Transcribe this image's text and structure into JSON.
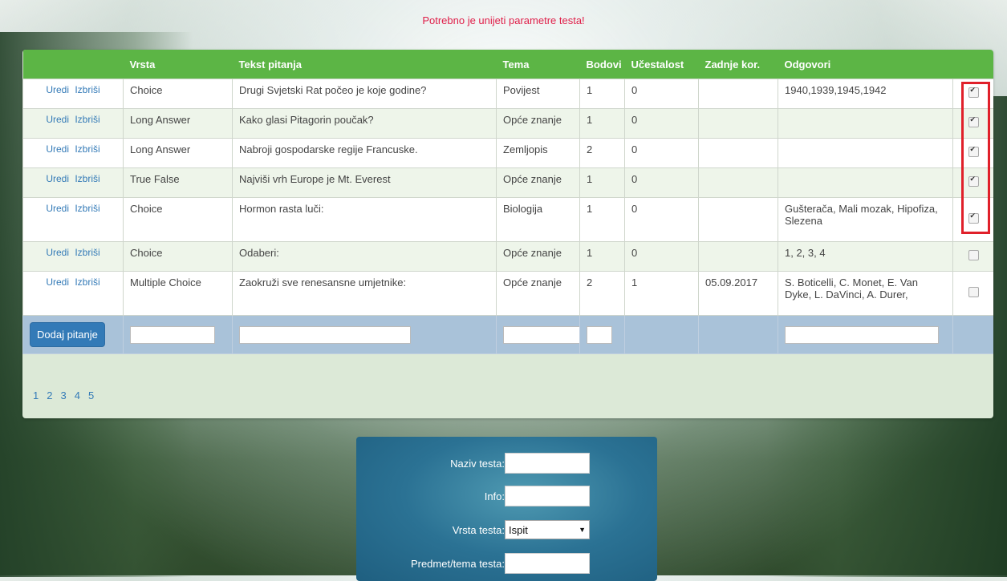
{
  "alert": "Potrebno je unijeti parametre testa!",
  "table": {
    "headers": [
      "",
      "Vrsta",
      "Tekst pitanja",
      "Tema",
      "Bodovi",
      "Učestalost",
      "Zadnje kor.",
      "Odgovori",
      ""
    ],
    "edit_label": "Uredi",
    "delete_label": "Izbriši",
    "rows": [
      {
        "vrsta": "Choice",
        "tekst": "Drugi Svjetski Rat počeo je koje godine?",
        "tema": "Povijest",
        "bodovi": "1",
        "ucestalost": "0",
        "zadnje": "",
        "odgovori": "1940,1939,1945,1942",
        "checked": true
      },
      {
        "vrsta": "Long Answer",
        "tekst": "Kako glasi Pitagorin poučak?",
        "tema": "Opće znanje",
        "bodovi": "1",
        "ucestalost": "0",
        "zadnje": "",
        "odgovori": "",
        "checked": true
      },
      {
        "vrsta": "Long Answer",
        "tekst": "Nabroji gospodarske regije Francuske.",
        "tema": "Zemljopis",
        "bodovi": "2",
        "ucestalost": "0",
        "zadnje": "",
        "odgovori": "",
        "checked": true
      },
      {
        "vrsta": "True False",
        "tekst": "Najviši vrh Europe je Mt. Everest",
        "tema": "Opće znanje",
        "bodovi": "1",
        "ucestalost": "0",
        "zadnje": "",
        "odgovori": "",
        "checked": true
      },
      {
        "vrsta": "Choice",
        "tekst": "Hormon rasta luči:",
        "tema": "Biologija",
        "bodovi": "1",
        "ucestalost": "0",
        "zadnje": "",
        "odgovori": "Gušterača, Mali mozak, Hipofiza, Slezena",
        "checked": true
      },
      {
        "vrsta": "Choice",
        "tekst": "Odaberi:",
        "tema": "Opće znanje",
        "bodovi": "1",
        "ucestalost": "0",
        "zadnje": "",
        "odgovori": "1, 2, 3, 4",
        "checked": false
      },
      {
        "vrsta": "Multiple Choice",
        "tekst": "Zaokruži sve renesansne umjetnike:",
        "tema": "Opće znanje",
        "bodovi": "2",
        "ucestalost": "1",
        "zadnje": "05.09.2017",
        "odgovori": "S. Boticelli, C. Monet, E. Van Dyke, L. DaVinci, A. Durer,",
        "checked": false
      }
    ],
    "add_button": "Dodaj pitanje"
  },
  "pagination": [
    "1",
    "2",
    "3",
    "4",
    "5"
  ],
  "test_form": {
    "naziv_label": "Naziv testa:",
    "info_label": "Info:",
    "vrsta_label": "Vrsta testa:",
    "vrsta_value": "Ispit",
    "predmet_label": "Predmet/tema testa:"
  },
  "colors": {
    "header": "#5cb545",
    "alert": "#e0204a",
    "link": "#337ab7",
    "input_row": "#a9c2d9",
    "highlight_box": "#e0202a"
  }
}
